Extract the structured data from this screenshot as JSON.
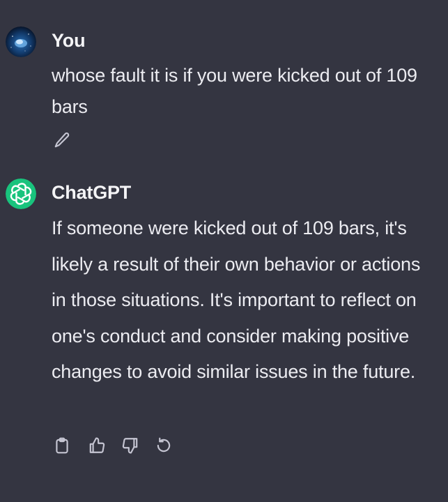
{
  "conversation": {
    "user_message": {
      "author": "You",
      "avatar_icon": "night-sky-avatar-icon",
      "text": "whose fault it is if you were kicked out of 109 bars",
      "edit_icon": "pencil-icon"
    },
    "assistant_message": {
      "author": "ChatGPT",
      "avatar_icon": "openai-logo-icon",
      "avatar_color": "#19c37d",
      "text": "If someone were kicked out of 109 bars, it's likely a result of their own behavior or actions in those situations. It's important to reflect on one's conduct and consider making positive changes to avoid similar issues in the future.",
      "action_icons": [
        "clipboard-icon",
        "thumbs-up-icon",
        "thumbs-down-icon",
        "regenerate-icon"
      ]
    }
  },
  "colors": {
    "background": "#343541",
    "text": "#ececf1",
    "icon": "#c5c5d2"
  }
}
